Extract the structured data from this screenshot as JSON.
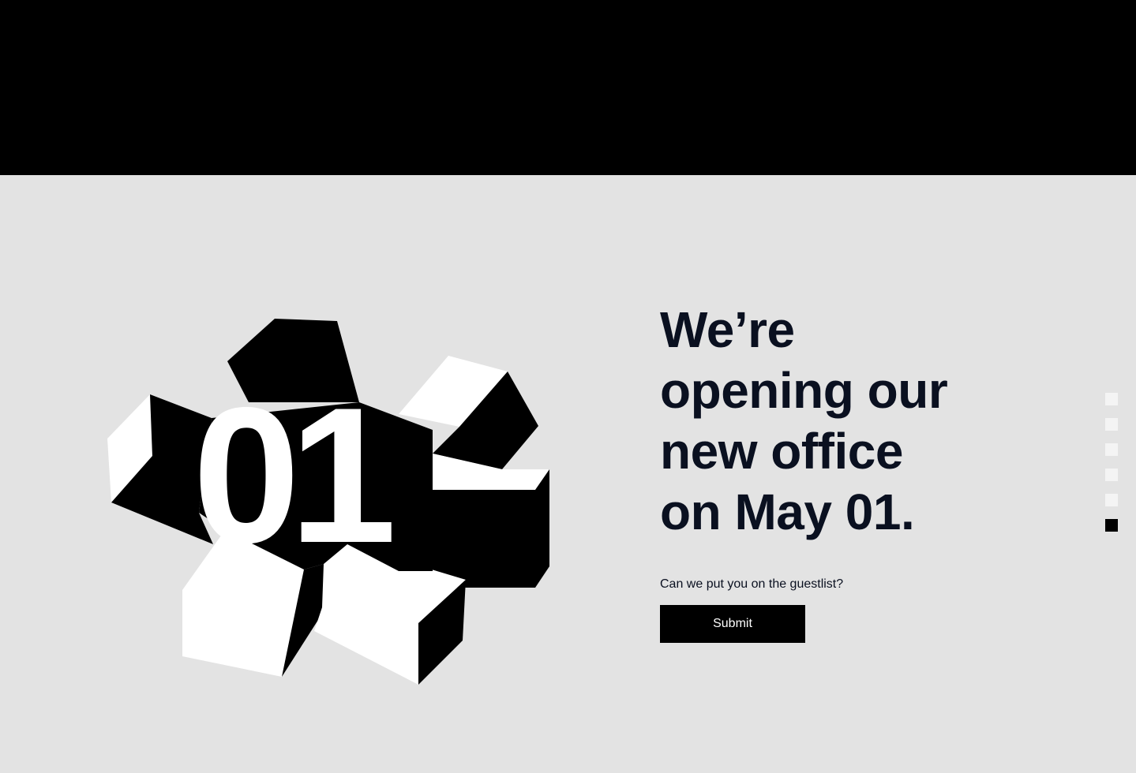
{
  "page": {
    "background_color": "#e3e3e3",
    "header_color": "#000000"
  },
  "logo": {
    "icon": "pinwheel-01-graphic",
    "text": "01"
  },
  "headline": {
    "lines": [
      "We’re",
      "opening our",
      "new office",
      "on May 01."
    ],
    "color": "#0a1020"
  },
  "guestlist": {
    "question": "Can we put you on the guestlist?",
    "submit_label": "Submit"
  },
  "pagination": {
    "total": 6,
    "active_index": 5
  }
}
